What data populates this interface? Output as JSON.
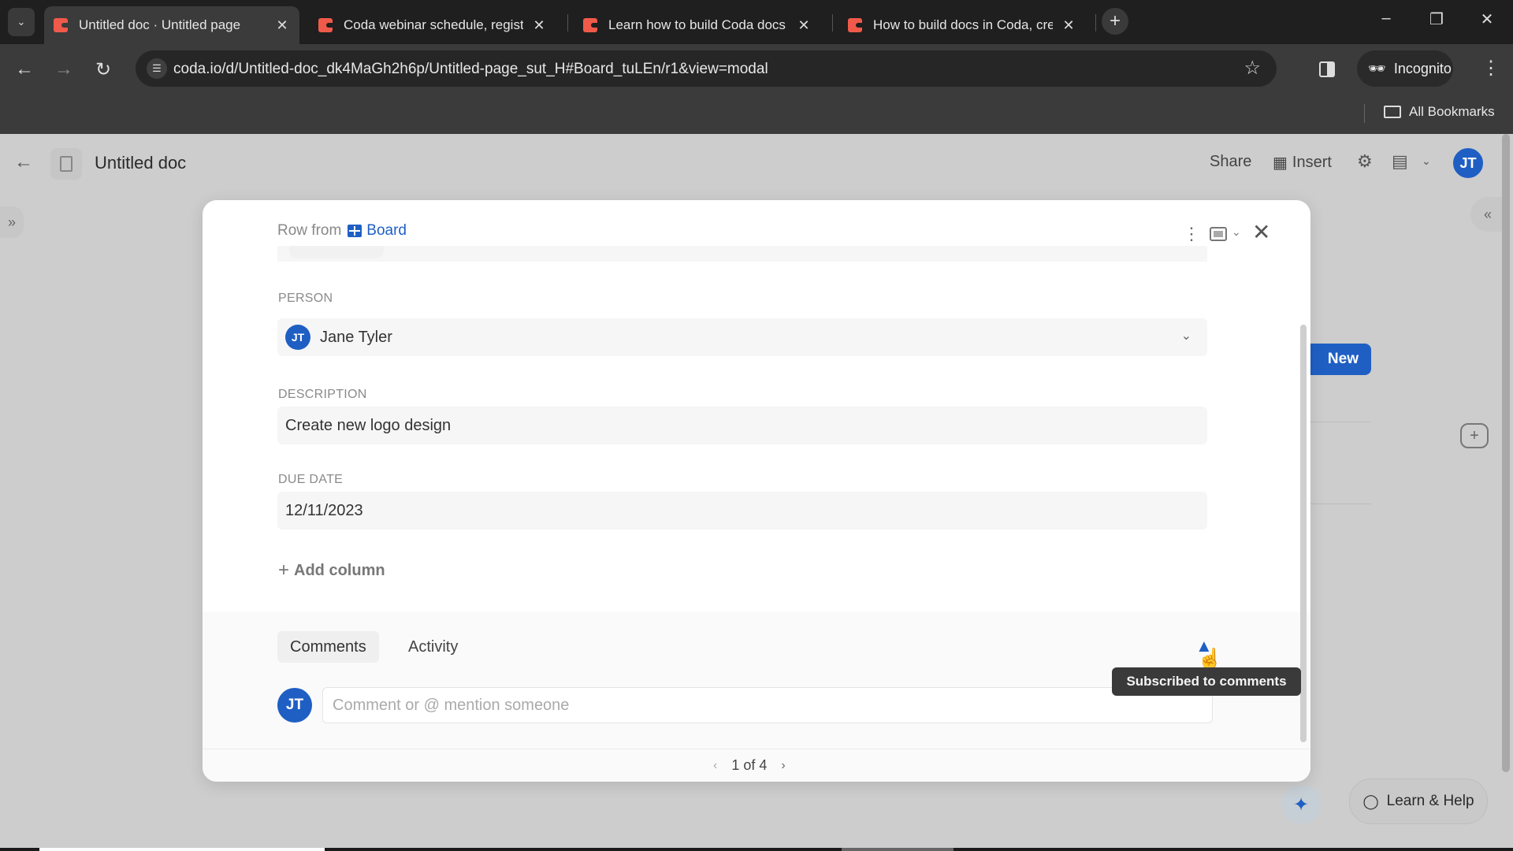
{
  "browser": {
    "tabs": [
      {
        "title": "Untitled doc · Untitled page",
        "active": true
      },
      {
        "title": "Coda webinar schedule, regist",
        "active": false
      },
      {
        "title": "Learn how to build Coda docs",
        "active": false
      },
      {
        "title": "How to build docs in Coda, cre",
        "active": false
      }
    ],
    "url": "coda.io/d/Untitled-doc_dk4MaGh2h6p/Untitled-page_sut_H#Board_tuLEn/r1&view=modal",
    "incognito_label": "Incognito",
    "bookmarks_label": "All Bookmarks",
    "icons": {
      "tab_list": "chevron-down-icon",
      "new_tab": "plus-icon",
      "minimize": "minimize-icon",
      "restore": "restore-icon",
      "close": "close-icon",
      "back": "arrow-left-icon",
      "forward": "arrow-right-icon",
      "reload": "reload-icon",
      "site_info": "tune-icon",
      "bookmark": "star-icon",
      "side_panel": "side-panel-icon",
      "menu": "kebab-icon",
      "folder": "folder-icon"
    }
  },
  "app": {
    "doc_title": "Untitled doc",
    "header": {
      "share_label": "Share",
      "insert_label": "Insert",
      "user_initials": "JT"
    },
    "new_button_label": "New",
    "learn_help_label": "Learn & Help"
  },
  "modal": {
    "row_from_prefix": "Row from",
    "table_name": "Board",
    "fields": [
      {
        "label": "PERSON",
        "value": "Jane Tyler",
        "avatar": "JT"
      },
      {
        "label": "DESCRIPTION",
        "value": "Create new logo design"
      },
      {
        "label": "DUE DATE",
        "value": "12/11/2023"
      }
    ],
    "add_column_label": "Add column",
    "tabs": [
      {
        "label": "Comments",
        "active": true
      },
      {
        "label": "Activity",
        "active": false
      }
    ],
    "comment_avatar": "JT",
    "comment_placeholder": "Comment or @ mention someone",
    "pagination": {
      "text": "1 of 4",
      "current": 1,
      "total": 4
    },
    "tooltip": "Subscribed to comments",
    "accent_color": "#1f5fc4"
  }
}
